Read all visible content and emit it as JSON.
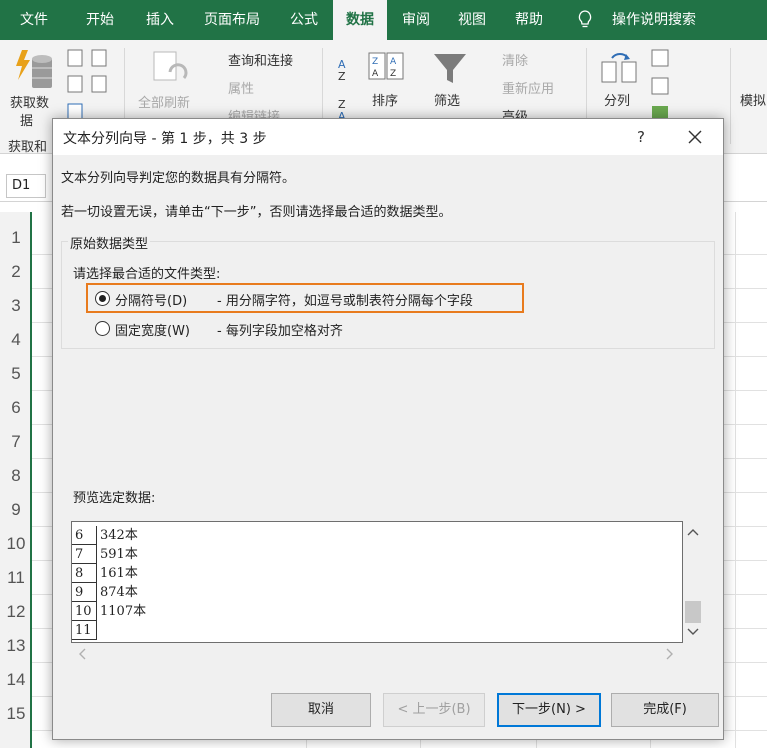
{
  "ribbon_tabs": [
    "文件",
    "开始",
    "插入",
    "页面布局",
    "公式",
    "数据",
    "审阅",
    "视图",
    "帮助"
  ],
  "active_tab": "数据",
  "search_label": "操作说明搜索",
  "ribbon": {
    "get_data": "获取数",
    "get_data_2": "据",
    "get_and_transform": "获取和",
    "query_connections": "查询和连接",
    "properties": "属性",
    "edit_links": "编辑链接",
    "refresh_all": "全部刷新",
    "sort": "排序",
    "filter": "筛选",
    "clear": "清除",
    "reapply": "重新应用",
    "advanced": "高级",
    "text_to_columns": "分列",
    "model": "模拟"
  },
  "name_box": "D1",
  "row_numbers": [
    "1",
    "2",
    "3",
    "4",
    "5",
    "6",
    "7",
    "8",
    "9",
    "10",
    "11",
    "12",
    "13",
    "14",
    "15"
  ],
  "dialog": {
    "title": "文本分列向导 - 第 1 步，共 3 步",
    "help": "?",
    "line1": "文本分列向导判定您的数据具有分隔符。",
    "line2": "若一切设置无误，请单击“下一步”，否则请选择最合适的数据类型。",
    "group_title": "原始数据类型",
    "prompt": "请选择最合适的文件类型:",
    "option_delimited": "分隔符号(D)",
    "option_delimited_desc": "- 用分隔字符，如逗号或制表符分隔每个字段",
    "option_fixed": "固定宽度(W)",
    "option_fixed_desc": "- 每列字段加空格对齐",
    "preview_label": "预览选定数据:",
    "preview_rows": [
      {
        "num": "6",
        "val": "342本"
      },
      {
        "num": "7",
        "val": "591本"
      },
      {
        "num": "8",
        "val": "161本"
      },
      {
        "num": "9",
        "val": "874本"
      },
      {
        "num": "10",
        "val": "1107本"
      },
      {
        "num": "11",
        "val": ""
      }
    ],
    "btn_cancel": "取消",
    "btn_back": "< 上一步(B)",
    "btn_next": "下一步(N) >",
    "btn_finish": "完成(F)"
  },
  "colors": {
    "excel_green": "#217346",
    "highlight_orange": "#e87b1e",
    "focus_blue": "#0078d7"
  },
  "icons": [
    "lightbulb-icon",
    "close-icon",
    "filter-funnel-icon",
    "sort-az-icon",
    "text-to-columns-icon",
    "get-data-icon",
    "refresh-icon"
  ]
}
